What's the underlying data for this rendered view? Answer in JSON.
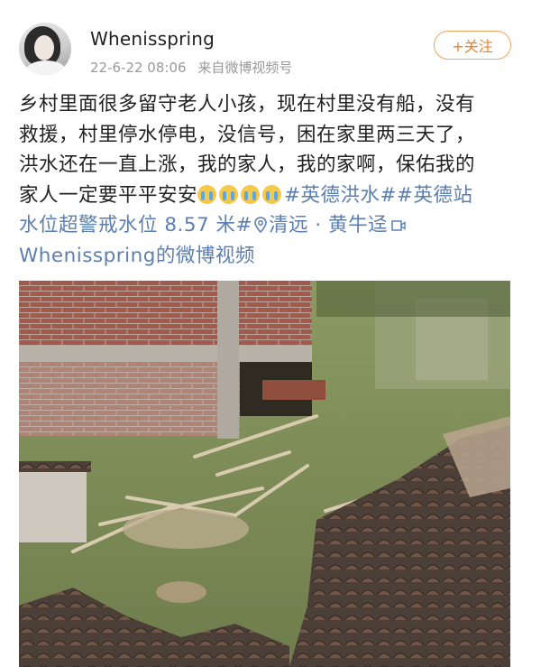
{
  "post": {
    "username": "Whenisspring",
    "timestamp": "22-6-22 08:06",
    "source": "来自微博视频号",
    "follow_label": "+关注",
    "text_line1": "乡村里面很多留守老人小孩，现在村里没有船，没有",
    "text_line2": "救援，村里停水停电，没信号，困在家里两三天了，",
    "text_line3": "洪水还在一直上涨，我的家人，我的家啊，保佑我的",
    "text_line4_plain": "家人一定要平平安安",
    "emoji": [
      "crying-emoji",
      "crying-emoji",
      "crying-emoji",
      "crying-emoji"
    ],
    "topic1": "#英德洪水#",
    "topic2_part1": "#英德站",
    "topic2_part2": "水位超警戒水位 8.57 米#",
    "location": "清远 · 黄牛迳",
    "video_link": "Whenisspring的微博视频"
  },
  "image": {
    "description_icon": "flood-photo"
  },
  "colors": {
    "link": "#5b7fb1",
    "follow": "#e9812d",
    "meta": "#9a9a9a"
  }
}
